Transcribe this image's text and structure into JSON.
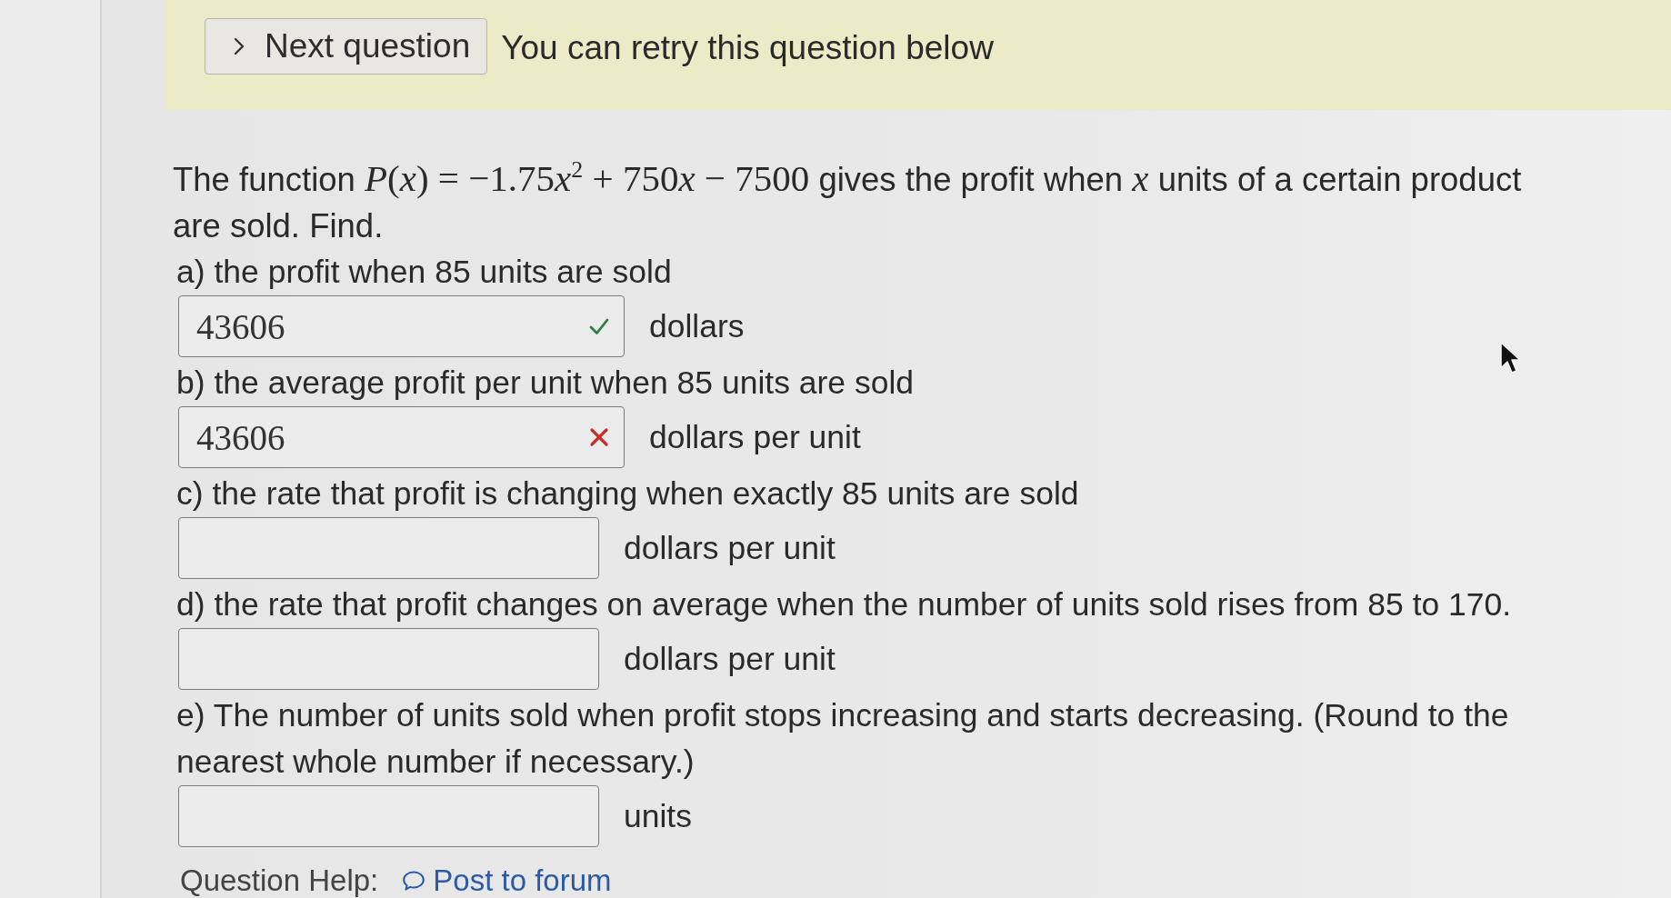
{
  "banner": {
    "button": {
      "label": "Next question"
    },
    "message": "You can retry this question below"
  },
  "question": {
    "intro": [
      {
        "kind": "text",
        "text": "The function "
      },
      {
        "kind": "variable",
        "text": "P"
      },
      {
        "kind": "math",
        "text": "("
      },
      {
        "kind": "variable",
        "text": "x"
      },
      {
        "kind": "math",
        "text": ") = −1.75"
      },
      {
        "kind": "variable",
        "text": "x"
      },
      {
        "kind": "superscript",
        "text": "2"
      },
      {
        "kind": "math",
        "text": " + 750"
      },
      {
        "kind": "variable",
        "text": "x"
      },
      {
        "kind": "math",
        "text": " − 7500"
      },
      {
        "kind": "text",
        "text": " gives the profit when "
      },
      {
        "kind": "variable",
        "text": "x"
      },
      {
        "kind": "text",
        "text": " units of a certain product are sold. Find."
      }
    ],
    "parts": [
      {
        "label": "a) the profit when 85 units are sold",
        "value": "43606",
        "kind": "correct",
        "unit": "dollars"
      },
      {
        "label": "b) the average profit per unit when 85 units are sold",
        "value": "43606",
        "kind": "incorrect",
        "unit": "dollars per unit"
      },
      {
        "label": "c) the rate that profit is changing when exactly 85 units are sold",
        "kind": "blank",
        "unit": "dollars per unit"
      },
      {
        "label": "d) the rate that profit changes on average when the number of units sold rises from 85 to 170.",
        "kind": "blank",
        "unit": "dollars per unit"
      },
      {
        "label": "e) The number of units sold when profit stops increasing and starts decreasing. (Round to the nearest whole number if necessary.)",
        "kind": "blank",
        "unit": "units"
      }
    ]
  },
  "help": {
    "label": "Question Help:",
    "link": "Post to forum"
  }
}
